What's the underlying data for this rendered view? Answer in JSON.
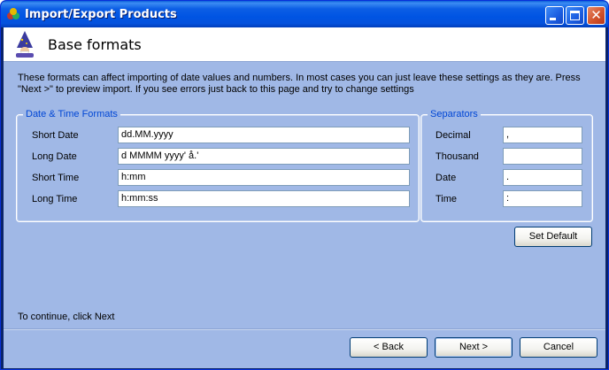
{
  "window": {
    "title": "Import/Export Products"
  },
  "header": {
    "title": "Base formats"
  },
  "description": "These formats can affect importing of date values and numbers. In most cases you can just leave these settings as they are. Press \"Next >\" to preview import. If you see errors just back to this page and try to change settings",
  "datetime_group": {
    "legend": "Date & Time Formats",
    "fields": [
      {
        "label": "Short Date",
        "value": "dd.MM.yyyy"
      },
      {
        "label": "Long Date",
        "value": "d MMMM yyyy' å.'"
      },
      {
        "label": "Short Time",
        "value": "h:mm"
      },
      {
        "label": "Long Time",
        "value": "h:mm:ss"
      }
    ]
  },
  "separators_group": {
    "legend": "Separators",
    "fields": [
      {
        "label": "Decimal",
        "value": ","
      },
      {
        "label": "Thousand",
        "value": ""
      },
      {
        "label": "Date",
        "value": "."
      },
      {
        "label": "Time",
        "value": ":"
      }
    ]
  },
  "buttons": {
    "set_default": "Set Default",
    "back": "< Back",
    "next": "Next >",
    "cancel": "Cancel"
  },
  "footer_text": "To continue, click Next",
  "icons": {
    "app": "app-icon",
    "wizard": "wizard-icon",
    "minimize": "minimize-icon",
    "maximize": "maximize-icon",
    "close": "close-icon"
  },
  "colors": {
    "titlebar": "#0054e3",
    "client_bg": "#a0b8e6",
    "group_legend": "#0046d5"
  }
}
